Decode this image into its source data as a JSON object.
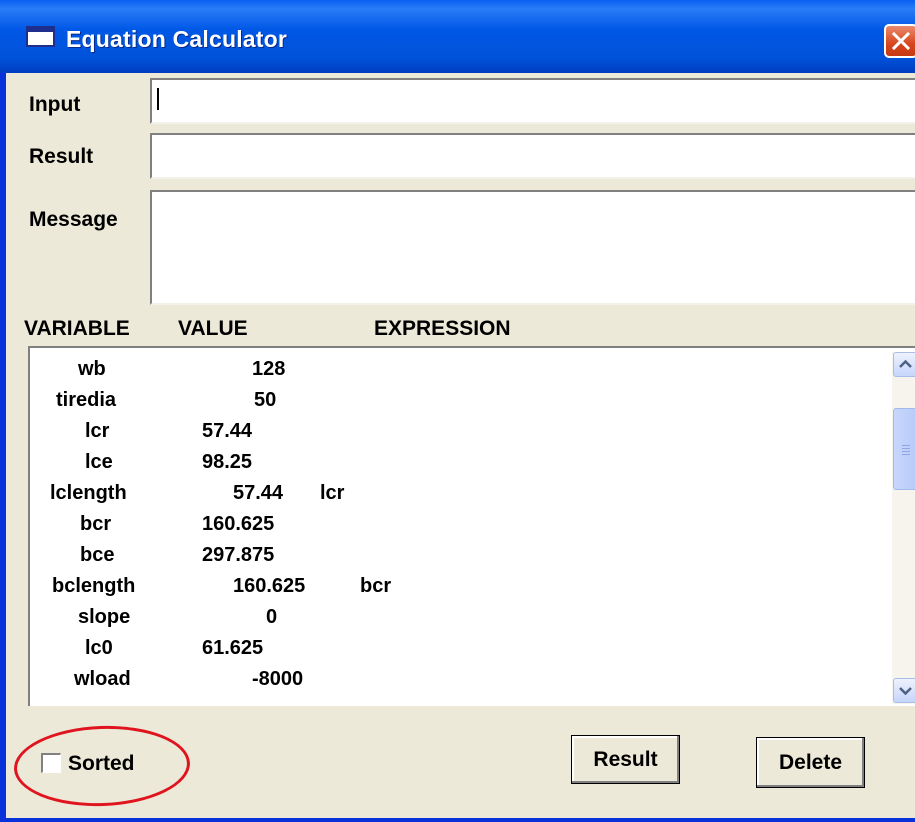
{
  "window": {
    "title": "Equation Calculator",
    "title_icon": "window-icon",
    "close_icon": "close-icon"
  },
  "form": {
    "input_label": "Input",
    "input_value": "",
    "result_label": "Result",
    "result_value": "",
    "message_label": "Message",
    "message_value": ""
  },
  "table": {
    "headers": {
      "variable": "VARIABLE",
      "value": "VALUE",
      "expression": "EXPRESSION"
    },
    "rows": [
      {
        "variable": "wb",
        "value": "128",
        "expression": ""
      },
      {
        "variable": "tiredia",
        "value": "50",
        "expression": ""
      },
      {
        "variable": "lcr",
        "value": "57.44",
        "expression": ""
      },
      {
        "variable": "lce",
        "value": "98.25",
        "expression": ""
      },
      {
        "variable": "lclength",
        "value": "57.44",
        "expression": "lcr"
      },
      {
        "variable": "bcr",
        "value": "160.625",
        "expression": ""
      },
      {
        "variable": "bce",
        "value": "297.875",
        "expression": ""
      },
      {
        "variable": "bclength",
        "value": "160.625",
        "expression": "bcr"
      },
      {
        "variable": "slope",
        "value": "0",
        "expression": ""
      },
      {
        "variable": "lc0",
        "value": "61.625",
        "expression": ""
      },
      {
        "variable": "wload",
        "value": "-8000",
        "expression": ""
      }
    ]
  },
  "footer": {
    "sorted_label": "Sorted",
    "sorted_checked": false,
    "result_button": "Result",
    "delete_button": "Delete"
  },
  "annotation": {
    "color": "#e0141e"
  }
}
